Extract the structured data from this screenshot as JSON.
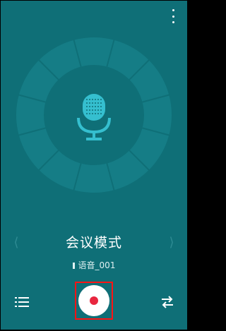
{
  "header": {
    "menu_icon": "more-vert-icon"
  },
  "recorder": {
    "visualizer_icon": "microphone-icon",
    "ring_segments": 12
  },
  "mode": {
    "title": "会议模式",
    "prev_icon": "chevron-left-icon",
    "next_icon": "chevron-right-icon"
  },
  "file": {
    "name": "语音_001"
  },
  "toolbar": {
    "list_icon": "list-icon",
    "record_icon": "record-icon",
    "swap_icon": "swap-icon"
  },
  "colors": {
    "background": "#0f6f77",
    "ring": "#157d86",
    "inner": "#0f6f77",
    "mic": "#35bfcf",
    "record_dot": "#e8263f",
    "highlight": "#ff1414"
  }
}
